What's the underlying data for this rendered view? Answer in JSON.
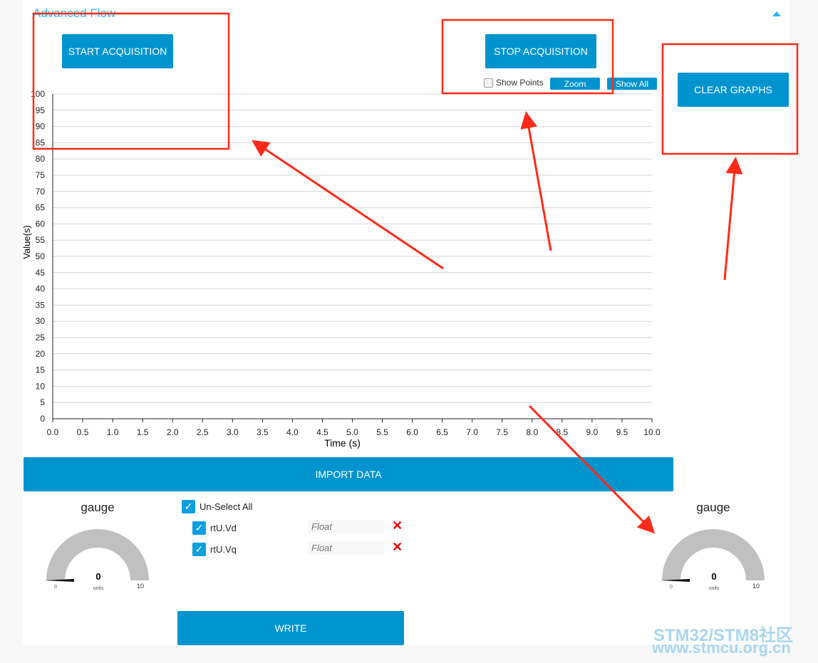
{
  "section_title": "Advanced Flow",
  "buttons": {
    "start": "START ACQUISITION",
    "stop": "STOP ACQUISITION",
    "clear": "CLEAR GRAPHS",
    "import": "IMPORT DATA",
    "write": "WRITE",
    "zoom": "Zoom",
    "show_all": "Show All"
  },
  "show_points": {
    "label": "Show Points",
    "checked": false
  },
  "chart_data": {
    "type": "line",
    "xlabel": "Time (s)",
    "ylabel": "Value(s)",
    "xlim": [
      0,
      10
    ],
    "ylim": [
      0,
      100
    ],
    "x_ticks": [
      "0.0",
      "0.5",
      "1.0",
      "1.5",
      "2.0",
      "2.5",
      "3.0",
      "3.5",
      "4.0",
      "4.5",
      "5.0",
      "5.5",
      "6.0",
      "6.5",
      "7.0",
      "7.5",
      "8.0",
      "8.5",
      "9.0",
      "9.5",
      "10.0"
    ],
    "y_ticks": [
      "0",
      "5",
      "10",
      "15",
      "20",
      "25",
      "30",
      "35",
      "40",
      "45",
      "50",
      "55",
      "60",
      "65",
      "70",
      "75",
      "80",
      "85",
      "90",
      "95",
      "100"
    ],
    "grid": true,
    "series": []
  },
  "gauges": [
    {
      "title": "gauge",
      "value": "0",
      "units": "units",
      "min": "0",
      "max": "10"
    },
    {
      "title": "gauge",
      "value": "0",
      "units": "units",
      "min": "0",
      "max": "10"
    }
  ],
  "variables": {
    "select_all": "Un-Select All",
    "items": [
      {
        "name": "rtU.Vd",
        "placeholder": "Float",
        "checked": true
      },
      {
        "name": "rtU.Vq",
        "placeholder": "Float",
        "checked": true
      }
    ]
  },
  "watermark": {
    "line1": "STM32/STM8社区",
    "line2": "www.stmcu.org.cn"
  },
  "colors": {
    "button": "#0094cf",
    "title": "#29b6f6",
    "annotation": "#ff2a1a"
  }
}
